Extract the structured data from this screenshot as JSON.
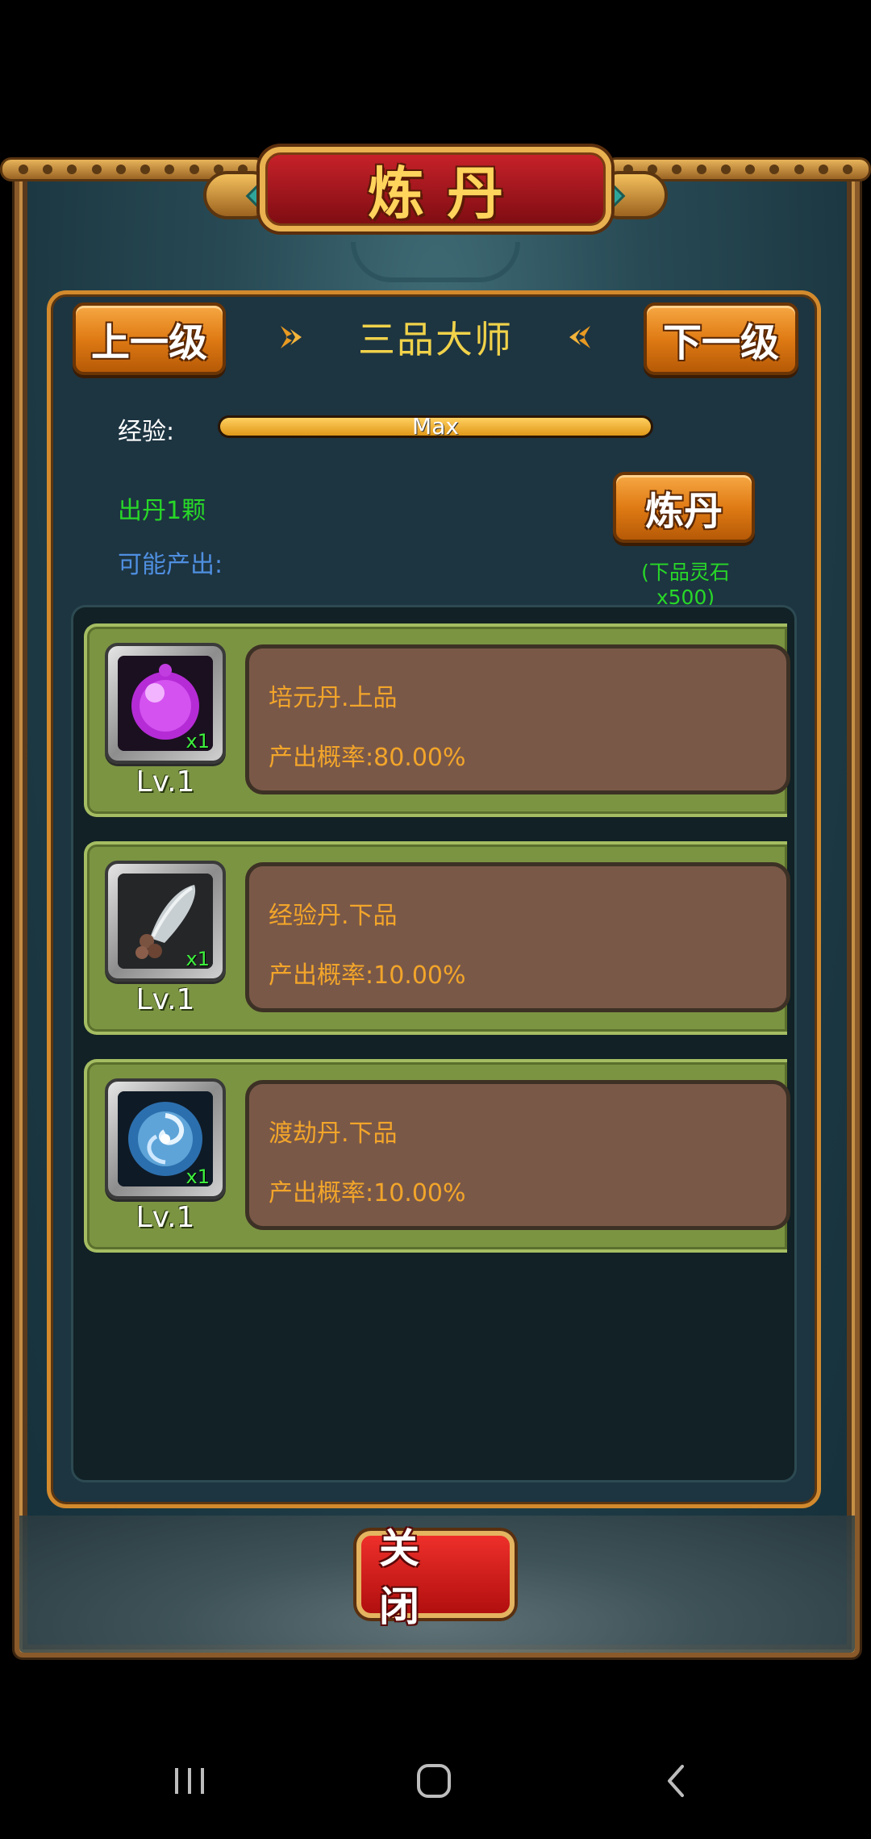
{
  "dialog": {
    "title": "炼丹",
    "close_label": "关 闭"
  },
  "rank": {
    "prev_label": "上一级",
    "next_label": "下一级",
    "title": "三品大师"
  },
  "experience": {
    "label": "经验:",
    "bar_text": "Max",
    "progress": 1.0
  },
  "refine": {
    "yield_text": "出丹1颗",
    "possible_label": "可能产出:",
    "button_label": "炼丹",
    "cost_text": "(下品灵石x500)"
  },
  "outputs": [
    {
      "name": "培元丹.上品",
      "rate": "产出概率:80.00%",
      "level": "Lv.1",
      "qty": "x1",
      "icon": "purple-orb-icon"
    },
    {
      "name": "经验丹.下品",
      "rate": "产出概率:10.00%",
      "level": "Lv.1",
      "qty": "x1",
      "icon": "silver-pill-icon"
    },
    {
      "name": "渡劫丹.下品",
      "rate": "产出概率:10.00%",
      "level": "Lv.1",
      "qty": "x1",
      "icon": "blue-vortex-icon"
    }
  ],
  "colors": {
    "accent_orange": "#e07b14",
    "title_gold": "#ffd45c",
    "green_text": "#28d828",
    "blue_text": "#4f8fe0",
    "item_text": "#f2a52a"
  },
  "navbar": {
    "icons": [
      "recents-icon",
      "home-icon",
      "back-icon"
    ]
  }
}
